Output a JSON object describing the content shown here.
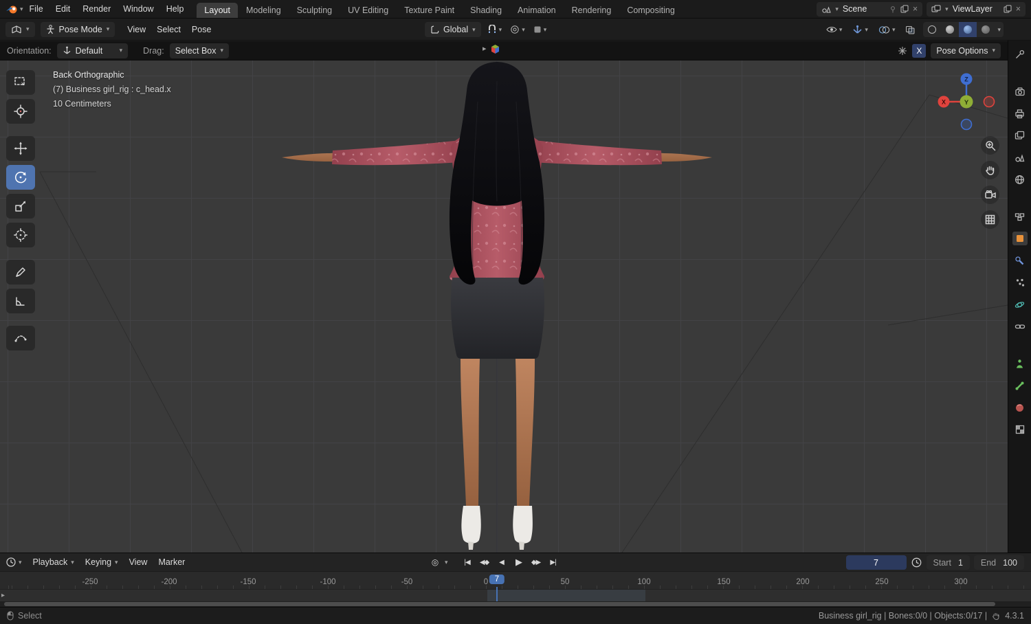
{
  "topbar": {
    "menus": [
      "File",
      "Edit",
      "Render",
      "Window",
      "Help"
    ],
    "workspaces": [
      "Layout",
      "Modeling",
      "Sculpting",
      "UV Editing",
      "Texture Paint",
      "Shading",
      "Animation",
      "Rendering",
      "Compositing"
    ],
    "active_workspace": "Layout",
    "scene": {
      "label": "Scene"
    },
    "viewlayer": {
      "label": "ViewLayer"
    }
  },
  "viewport_header": {
    "mode": "Pose Mode",
    "menus": [
      "View",
      "Select",
      "Pose"
    ],
    "orientation": "Global"
  },
  "tool_settings": {
    "orientation_label": "Orientation:",
    "orientation_value": "Default",
    "drag_label": "Drag:",
    "drag_value": "Select Box",
    "mirror_x": "X",
    "pose_options": "Pose Options"
  },
  "viewport": {
    "view_label": "Back Orthographic",
    "selection_label": "(7) Business girl_rig : c_head.x",
    "scale_label": "10 Centimeters",
    "axis_z": "Z",
    "axis_y": "Y",
    "axis_x": "X"
  },
  "timeline": {
    "menus": [
      "Playback",
      "Keying",
      "View",
      "Marker"
    ],
    "current_frame": "7",
    "playhead_frame": "7",
    "start_label": "Start",
    "start_value": "1",
    "end_label": "End",
    "end_value": "100",
    "ticks": [
      "-250",
      "-200",
      "-150",
      "-100",
      "-50",
      "0",
      "50",
      "100",
      "150",
      "200",
      "250",
      "300"
    ]
  },
  "statusbar": {
    "left": "Select",
    "info": "Business girl_rig | Bones:0/0 | Objects:0/17 |",
    "version": "4.3.1"
  },
  "icons": {
    "chevron_down": "▾",
    "chevron_right": "▸",
    "collapse_left": "‹",
    "jump_start": "|◀",
    "prev_keyframe": "◀◆",
    "play_reverse": "◀",
    "play": "▶",
    "next_keyframe": "◆▶",
    "jump_end": "▶|",
    "autokey": "◎",
    "close": "×"
  },
  "colors": {
    "accent": "#4772b3",
    "axis_x": "#e0433d",
    "axis_y": "#8fae36",
    "axis_z": "#3f6ed2"
  }
}
